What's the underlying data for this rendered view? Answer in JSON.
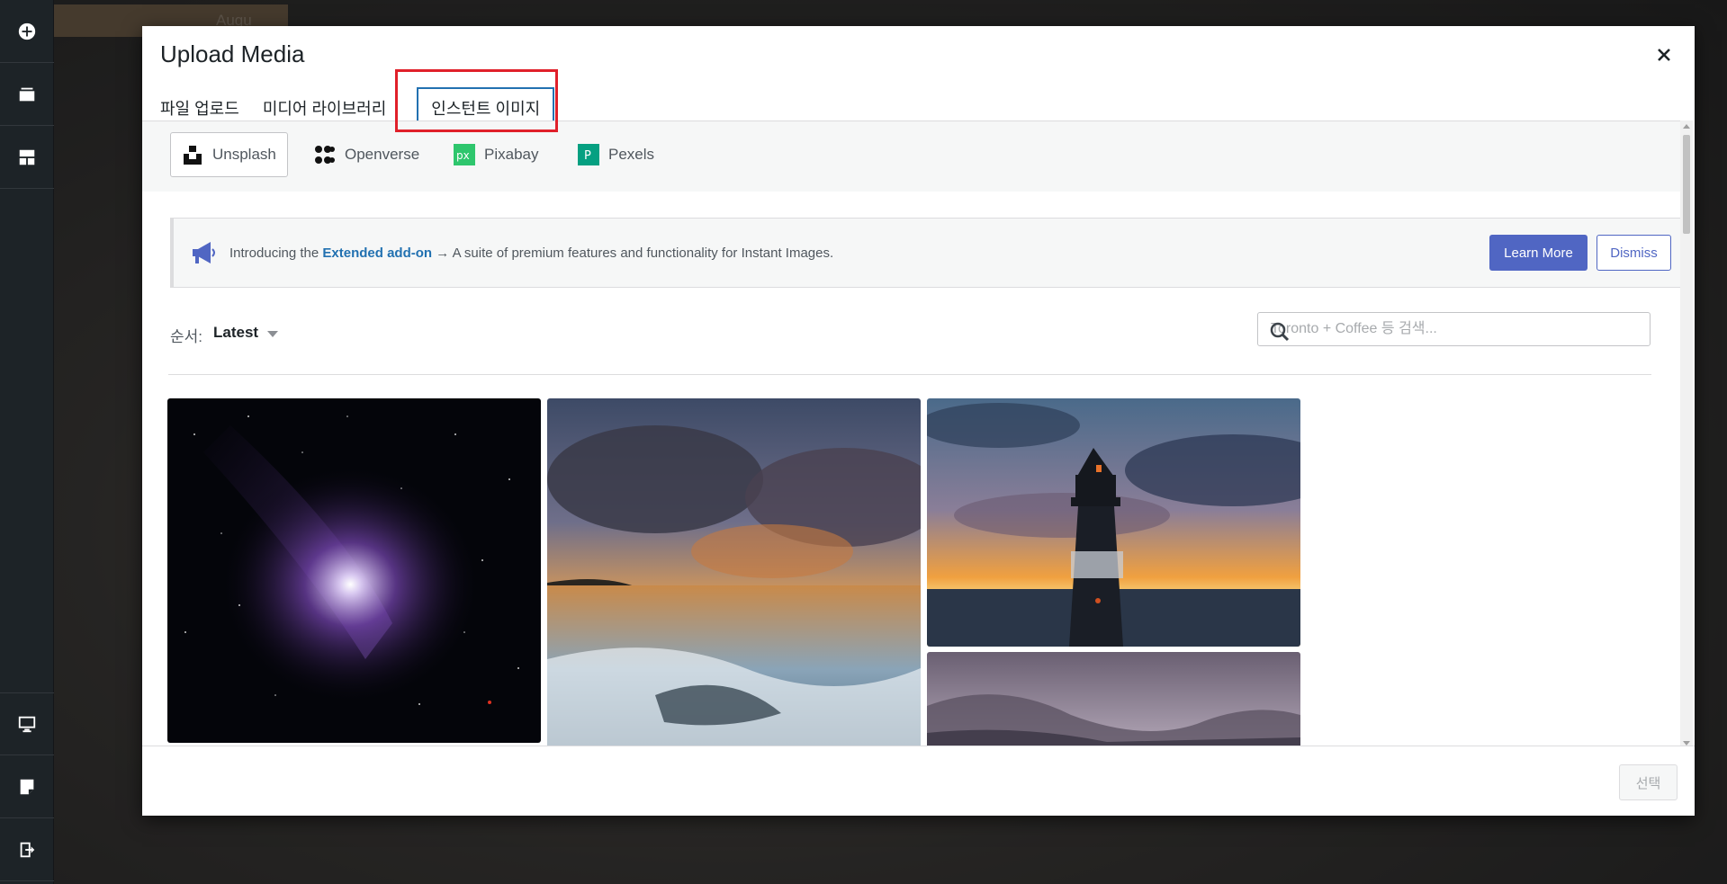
{
  "background": {
    "chip_text": "Augu"
  },
  "modal": {
    "title": "Upload Media",
    "close_label": "×",
    "tabs": [
      {
        "label": "파일 업로드",
        "active": false
      },
      {
        "label": "미디어 라이브러리",
        "active": false
      },
      {
        "label": "인스턴트 이미지",
        "active": true
      }
    ]
  },
  "providers": [
    {
      "name": "Unsplash",
      "icon": "unsplash-icon",
      "active": true
    },
    {
      "name": "Openverse",
      "icon": "openverse-icon",
      "active": false
    },
    {
      "name": "Pixabay",
      "icon": "pixabay-icon",
      "active": false
    },
    {
      "name": "Pexels",
      "icon": "pexels-icon",
      "active": false
    }
  ],
  "notice": {
    "prefix": "Introducing the ",
    "link": "Extended add-on",
    "suffix": " → A suite of premium features and functionality for Instant Images.",
    "learn_more": "Learn More",
    "dismiss": "Dismiss"
  },
  "sort": {
    "label": "순서:",
    "value": "Latest"
  },
  "search": {
    "placeholder": "Toronto + Coffee 등 검색..."
  },
  "photos": [
    {
      "subject": "comet in starry night sky"
    },
    {
      "subject": "ocean waves at sunset with clouds"
    },
    {
      "subject": "lighthouse silhouette at sunset"
    },
    {
      "subject": "misty mountain valley"
    }
  ],
  "footer": {
    "select_label": "선택"
  },
  "colors": {
    "accent": "#2271b1",
    "button_primary": "#5066c3",
    "highlight": "#e0202a",
    "sidebar": "#1d2327"
  }
}
